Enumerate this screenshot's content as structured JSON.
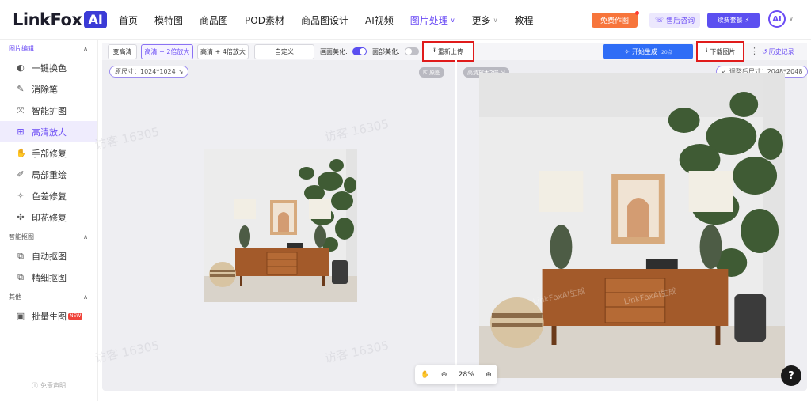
{
  "brand": {
    "name": "LinkFox",
    "badge": "AI"
  },
  "nav": {
    "items": [
      {
        "label": "首页",
        "active": false,
        "has_dropdown": false
      },
      {
        "label": "模特图",
        "active": false,
        "has_dropdown": false
      },
      {
        "label": "商品图",
        "active": false,
        "has_dropdown": false
      },
      {
        "label": "POD素材",
        "active": false,
        "has_dropdown": false
      },
      {
        "label": "商品图设计",
        "active": false,
        "has_dropdown": false
      },
      {
        "label": "AI视频",
        "active": false,
        "has_dropdown": false
      },
      {
        "label": "图片处理",
        "active": true,
        "has_dropdown": true
      },
      {
        "label": "更多",
        "active": false,
        "has_dropdown": true
      },
      {
        "label": "教程",
        "active": false,
        "has_dropdown": false
      }
    ],
    "free_label": "免费作图",
    "consult_label": "售后咨询",
    "renew_label": "续费套餐",
    "avatar_label": "AI"
  },
  "sidebar": {
    "sections": [
      {
        "title": "图片编辑",
        "items": [
          {
            "label": "一键换色",
            "icon": "color-swap-icon",
            "glyph": "◐",
            "active": false
          },
          {
            "label": "消除笔",
            "icon": "eraser-pen-icon",
            "glyph": "✎",
            "active": false
          },
          {
            "label": "智能扩图",
            "icon": "expand-icon",
            "glyph": "⤧",
            "active": false
          },
          {
            "label": "高清放大",
            "icon": "upscale-icon",
            "glyph": "⊞",
            "active": true
          },
          {
            "label": "手部修复",
            "icon": "hand-icon",
            "glyph": "✋",
            "active": false
          },
          {
            "label": "局部重绘",
            "icon": "repaint-icon",
            "glyph": "✐",
            "active": false
          },
          {
            "label": "色差修复",
            "icon": "color-fix-icon",
            "glyph": "✧",
            "active": false
          },
          {
            "label": "印花修复",
            "icon": "print-fix-icon",
            "glyph": "✣",
            "active": false
          }
        ]
      },
      {
        "title": "智能抠图",
        "items": [
          {
            "label": "自动抠图",
            "icon": "auto-cutout-icon",
            "glyph": "⧉",
            "active": false
          },
          {
            "label": "精细抠图",
            "icon": "fine-cutout-icon",
            "glyph": "⧉",
            "active": false
          }
        ]
      },
      {
        "title": "其他",
        "items": [
          {
            "label": "批量生图",
            "icon": "batch-icon",
            "glyph": "▣",
            "active": false,
            "badge": "NEW"
          }
        ]
      }
    ],
    "disclaimer": "免责声明"
  },
  "toolbar": {
    "options": [
      {
        "label": "变高清",
        "active": false
      },
      {
        "label": "高清 + 2倍放大",
        "active": true
      },
      {
        "label": "高清 + 4倍放大",
        "active": false
      },
      {
        "label": "自定义",
        "active": false
      }
    ],
    "beautify_label": "画面美化:",
    "beautify_on": true,
    "face_label": "面部美化:",
    "face_on": false,
    "reupload_label": "重新上传",
    "generate_label": "开始生成",
    "generate_cost": "20点",
    "download_label": "下载图片",
    "history_label": "历史记录"
  },
  "left_pane": {
    "size_label": "原尺寸：1024*1024",
    "tag": "原图"
  },
  "right_pane": {
    "tag": "高清放大2倍",
    "size_label": "调整后尺寸：2048*2048"
  },
  "zoom": {
    "value": "28%"
  },
  "help_label": "?",
  "watermark_text": "访客 16305",
  "image_watermark": "LinkFoxAI生成",
  "colors": {
    "accent": "#6b4cf5",
    "primary_blue": "#2f6df6",
    "highlight_red": "#e01b1b",
    "orange": "#f7753b"
  }
}
